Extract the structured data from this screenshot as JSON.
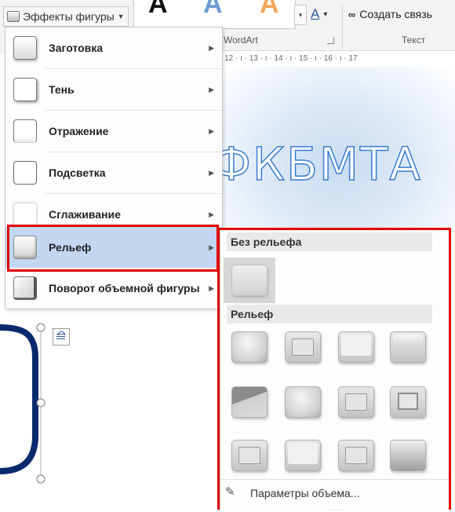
{
  "ribbon": {
    "shape_effects_label": "Эффекты фигуры",
    "wordart_group": "WordArt",
    "text_fill_letter": "A",
    "create_link_label": "Создать связь",
    "text_group": "Текст",
    "gallery_glyph_1": "A",
    "gallery_glyph_2": "A",
    "gallery_glyph_3": "A",
    "ruler_text": "· 12 · ı · 13 · ı · 14 · ı · 15 · ı · 16 · ı · 17"
  },
  "document": {
    "wordart_text": "ФКБМТА"
  },
  "menu": {
    "items": [
      {
        "label": "Заготовка"
      },
      {
        "label": "Тень"
      },
      {
        "label": "Отражение"
      },
      {
        "label": "Подсветка"
      },
      {
        "label": "Сглаживание"
      },
      {
        "label": "Рельеф"
      },
      {
        "label": "Поворот объемной фигуры"
      }
    ],
    "arrow": "▶"
  },
  "submenu": {
    "no_bevel_header": "Без рельефа",
    "bevel_header": "Рельеф",
    "options_label": "Параметры объема...",
    "grip": "....."
  },
  "colors": {
    "highlight": "#c4d7f1",
    "red_frame": "#e00000",
    "wordart_outline": "#3a7dd1",
    "connector": "#0b2a6e"
  },
  "icons": {
    "shape_effects": "shape-effects-icon",
    "text_fill": "text-fill-icon",
    "link": "chain-link-icon",
    "options": "pen-icon",
    "layout": "layout-options-icon"
  }
}
